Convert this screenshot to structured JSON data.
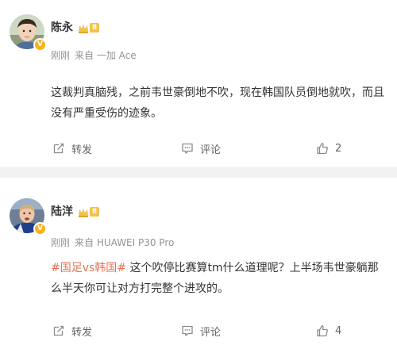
{
  "posts": [
    {
      "author": "陈永",
      "level": "8",
      "meta": {
        "time": "刚刚",
        "source": "来自 一加 Ace"
      },
      "content": "这裁判真脑残，之前韦世豪倒地不吹，现在韩国队员倒地就吹，而且没有严重受伤的迹象。",
      "actions": {
        "repost": "转发",
        "comment": "评论",
        "like_count": "2"
      }
    },
    {
      "author": "陆洋",
      "level": "8",
      "meta": {
        "time": "刚刚",
        "source": "来自 HUAWEI P30 Pro"
      },
      "hashtag": "#国足vs韩国#",
      "content": " 这个吹停比赛算tm什么道理呢？上半场韦世豪躺那么半天你可让对方打完整个进攻的。",
      "actions": {
        "repost": "转发",
        "comment": "评论",
        "like_count": "4"
      }
    }
  ],
  "colors": {
    "hashtag": "#eb7350",
    "meta_text": "#939393",
    "action_text": "#636363",
    "separator": "#f2f2f2",
    "badge_gold": "#f5c14a"
  }
}
